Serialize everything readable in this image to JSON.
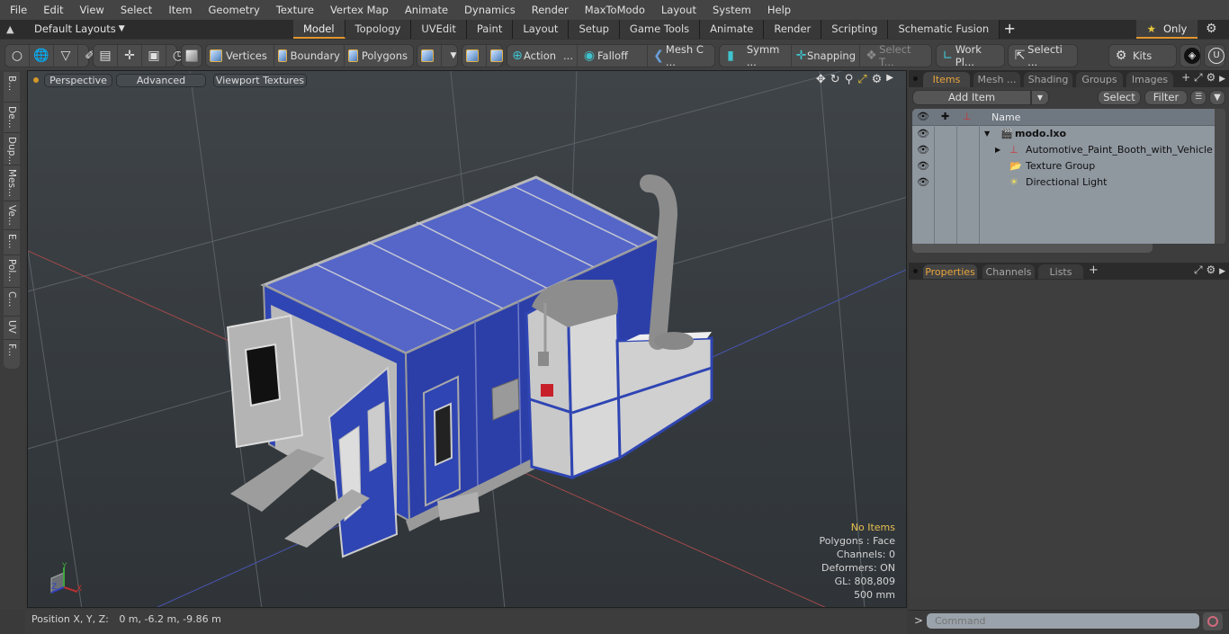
{
  "menu": [
    "File",
    "Edit",
    "View",
    "Select",
    "Item",
    "Geometry",
    "Texture",
    "Vertex Map",
    "Animate",
    "Dynamics",
    "Render",
    "MaxToModo",
    "Layout",
    "System",
    "Help"
  ],
  "layouts": {
    "selector_label": "Default Layouts",
    "tabs": [
      "Model",
      "Topology",
      "UVEdit",
      "Paint",
      "Layout",
      "Setup",
      "Game Tools",
      "Animate",
      "Render",
      "Scripting",
      "Schematic Fusion"
    ],
    "active_tab": "Model",
    "only_label": "Only"
  },
  "toolbar": {
    "vertices": "Vertices",
    "boundary": "Boundary",
    "polygons": "Polygons",
    "action": "Action",
    "falloff": "Falloff",
    "mesh_c": "Mesh C ...",
    "symm": "Symm ...",
    "snapping": "Snapping",
    "select_t": "Select T...",
    "work_pl": "Work Pl...",
    "selecti": "Selecti ...",
    "kits": "Kits",
    "ellipsis": "..."
  },
  "left_tabs": [
    "B...",
    "De...",
    "Dup...",
    "Mes...",
    "Ve...",
    "E...",
    "Pol...",
    "C...",
    "UV",
    "F..."
  ],
  "viewport": {
    "view_mode": "Perspective",
    "shading": "Advanced",
    "textures": "Viewport Textures",
    "stats": {
      "selection": "No Items",
      "polygons": "Polygons : Face",
      "channels": "Channels: 0",
      "deformers": "Deformers: ON",
      "gl": "GL: 808,809",
      "grid": "500 mm"
    },
    "gizmo": {
      "x": "X",
      "y": "Y",
      "z": "Z"
    }
  },
  "status": {
    "position_label": "Position X, Y, Z:",
    "position_value": "0 m, -6.2 m, -9.86 m"
  },
  "items_panel": {
    "tabs": [
      "Items",
      "Mesh ...",
      "Shading",
      "Groups",
      "Images"
    ],
    "active_tab": "Items",
    "add_item": "Add Item",
    "select": "Select",
    "filter": "Filter",
    "column_name": "Name",
    "tree": [
      {
        "label": "modo.lxo",
        "icon": "scene-clapper-icon",
        "level": 0,
        "expanded": true
      },
      {
        "label": "Automotive_Paint_Booth_with_Vehicle",
        "icon": "mesh-locator-icon",
        "level": 1,
        "expanded": false
      },
      {
        "label": "Texture Group",
        "icon": "folder-icon",
        "level": 1
      },
      {
        "label": "Directional Light",
        "icon": "light-icon",
        "level": 1
      }
    ]
  },
  "properties_panel": {
    "tabs": [
      "Properties",
      "Channels",
      "Lists"
    ],
    "active_tab": "Properties"
  },
  "command": {
    "prompt": ">",
    "placeholder": "Command"
  },
  "colors": {
    "accent": "#e0962e",
    "booth_blue": "#3a4fb8",
    "warning_text": "#e8c053"
  }
}
